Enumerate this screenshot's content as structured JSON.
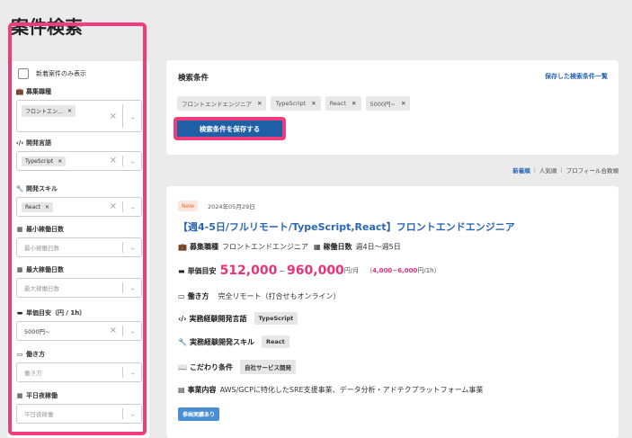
{
  "page": {
    "title": "案件検索"
  },
  "sidebar": {
    "new_only_label": "新着案件のみ表示",
    "filters": [
      {
        "label": "募集職種",
        "icon": "briefcase-icon",
        "chips": [
          "フロントエン…"
        ]
      },
      {
        "label": "開発言語",
        "icon": "code-icon",
        "chips": [
          "TypeScript"
        ]
      },
      {
        "label": "開発スキル",
        "icon": "wrench-icon",
        "chips": [
          "React"
        ]
      },
      {
        "label": "最小稼働日数",
        "icon": "calendar-icon",
        "placeholder": "最小稼働日数"
      },
      {
        "label": "最大稼働日数",
        "icon": "calendar-icon",
        "placeholder": "最大稼働日数"
      },
      {
        "label": "単価目安（円 / 1h）",
        "icon": "money-icon",
        "value": "5000円~"
      },
      {
        "label": "働き方",
        "icon": "monitor-icon",
        "placeholder": "働き方"
      },
      {
        "label": "平日夜稼働",
        "icon": "calendar-icon",
        "placeholder": "平日夜稼働"
      }
    ]
  },
  "conditions": {
    "title": "検索条件",
    "saved_link": "保存した検索条件一覧",
    "chips": [
      "フロントエンドエンジニア",
      "TypeScript",
      "React",
      "5000円~"
    ],
    "save_button": "検索条件を保存する"
  },
  "sort": {
    "options": [
      "新着順",
      "人気順",
      "プロフィール合致順"
    ],
    "active": "新着順"
  },
  "job": {
    "badge": "New",
    "date": "2024年05月29日",
    "title": "【週4-5日/フルリモート/TypeScript,React】フロントエンドエンジニア",
    "role_label": "募集職種",
    "role_value": "フロントエンドエンジニア",
    "days_label": "稼働日数",
    "days_value": "週4日〜週5日",
    "price_label": "単価目安",
    "price_min": "512,000",
    "price_tilde": "~",
    "price_max": "960,000",
    "price_unit": "円/月",
    "hourly_open": "（",
    "hourly_min": "4,000",
    "hourly_tilde": "~",
    "hourly_max": "6,000",
    "hourly_unit": "円/1h）",
    "workstyle_label": "働き方",
    "workstyle_value": "完全リモート（打合せもオンライン）",
    "lang_label": "実務経験開発言語",
    "lang_tag": "TypeScript",
    "skill_label": "実務経験開発スキル",
    "skill_tag": "React",
    "pref_label": "こだわり条件",
    "pref_tag": "自社サービス開発",
    "business_label": "事業内容",
    "business_value": "AWS/GCPに特化したSRE支援事業、データ分析・アドテクプラットフォーム事業",
    "blue_tag": "参画実績あり"
  },
  "colors": {
    "accent": "#2b66b5",
    "highlight": "#f03c7a",
    "price": "#e8327a",
    "button": "#1f5fa6"
  }
}
